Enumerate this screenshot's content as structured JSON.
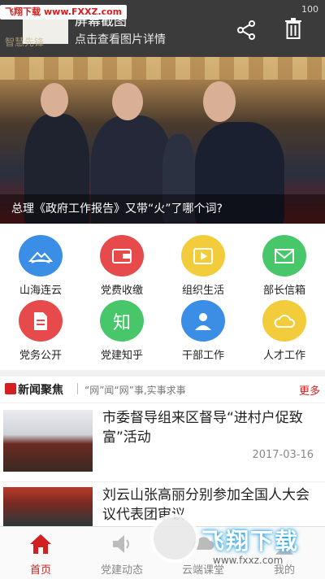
{
  "topbar": {
    "watermark_text": "飞翔下载",
    "watermark_site": "www.FXXZ.com",
    "title": "屏幕截图",
    "subtitle": "点击查看图片详情",
    "status_battery": "100",
    "logo_text": "智慧先锋",
    "share_icon": "share-icon",
    "trash_icon": "trash-icon"
  },
  "hero": {
    "caption": "总理《政府工作报告》又带“火”了哪个词?"
  },
  "grid": {
    "items": [
      {
        "label": "山海连云",
        "color": "#3a8ee6",
        "icon": "mountain-icon"
      },
      {
        "label": "党费收缴",
        "color": "#e64a4a",
        "icon": "wallet-icon"
      },
      {
        "label": "组织生活",
        "color": "#f2cc3a",
        "icon": "play-icon"
      },
      {
        "label": "部长信箱",
        "color": "#47c76a",
        "icon": "mail-icon"
      },
      {
        "label": "党务公开",
        "color": "#e64a4a",
        "icon": "document-icon"
      },
      {
        "label": "党建知乎",
        "color": "#47c76a",
        "icon_text": "知",
        "icon": "zhihu-icon"
      },
      {
        "label": "干部工作",
        "color": "#3a8ee6",
        "icon": "user-icon"
      },
      {
        "label": "人才工作",
        "color": "#f2cc3a",
        "icon": "cloud-icon"
      }
    ]
  },
  "news": {
    "title": "新闻聚焦",
    "slogan": "“网”闻“网”事,实事求事",
    "more": "更多",
    "items": [
      {
        "headline": "市委督导组来区督导“进村户促致富”活动",
        "date": "2017-03-16"
      },
      {
        "headline": "刘云山张高丽分别参加全国人大会议代表团审议",
        "date": ""
      }
    ]
  },
  "nav": {
    "items": [
      {
        "label": "首页",
        "active": true
      },
      {
        "label": "党建动态",
        "active": false
      },
      {
        "label": "云端课堂",
        "active": false
      },
      {
        "label": "我的",
        "active": false
      }
    ]
  },
  "watermark": {
    "brand": "飞翔下载",
    "url": "www.fxxz.com"
  },
  "colors": {
    "accent": "#d21f1f",
    "topbar": "#3b3b3b"
  }
}
